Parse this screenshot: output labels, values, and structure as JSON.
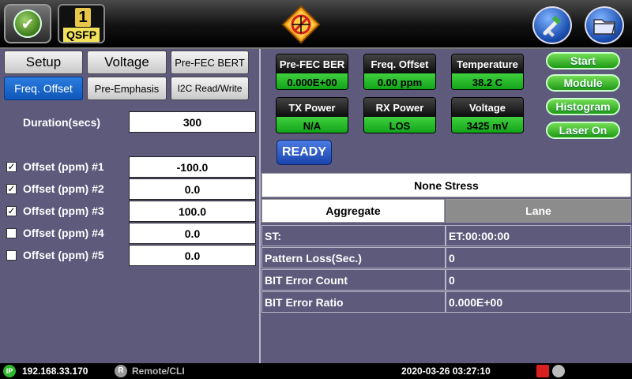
{
  "header": {
    "module_number": "1",
    "module_label": "QSFP"
  },
  "tabs": [
    {
      "label": "Setup"
    },
    {
      "label": "Voltage"
    },
    {
      "label": "Pre-FEC BERT"
    },
    {
      "label": "Freq. Offset"
    },
    {
      "label": "Pre-Emphasis"
    },
    {
      "label": "I2C Read/Write"
    }
  ],
  "duration": {
    "label": "Duration(secs)",
    "value": "300"
  },
  "offsets": [
    {
      "label": "Offset (ppm) #1",
      "value": "-100.0",
      "checked": true
    },
    {
      "label": "Offset (ppm) #2",
      "value": "0.0",
      "checked": true
    },
    {
      "label": "Offset (ppm) #3",
      "value": "100.0",
      "checked": true
    },
    {
      "label": "Offset (ppm) #4",
      "value": "0.0",
      "checked": false
    },
    {
      "label": "Offset (ppm) #5",
      "value": "0.0",
      "checked": false
    }
  ],
  "status_tiles": [
    {
      "title": "Pre-FEC BER",
      "value": "0.000E+00"
    },
    {
      "title": "Freq. Offset",
      "value": "0.00 ppm"
    },
    {
      "title": "Temperature",
      "value": "38.2 C"
    },
    {
      "title": "TX Power",
      "value": "N/A"
    },
    {
      "title": "RX Power",
      "value": "LOS"
    },
    {
      "title": "Voltage",
      "value": "3425 mV"
    }
  ],
  "ready_label": "READY",
  "side_buttons": [
    "Start",
    "Module",
    "Histogram",
    "Laser On"
  ],
  "results": {
    "stress_title": "None Stress",
    "tab_aggregate": "Aggregate",
    "tab_lane": "Lane",
    "rows": [
      {
        "left": "ST:",
        "right": "ET:00:00:00"
      },
      {
        "left": "Pattern Loss(Sec.)",
        "right": "0"
      },
      {
        "left": "BIT Error Count",
        "right": "0"
      },
      {
        "left": "BIT Error Ratio",
        "right": "0.000E+00"
      }
    ]
  },
  "statusbar": {
    "ip_badge": "IP",
    "ip": "192.168.33.170",
    "remote_badge": "R",
    "remote": "Remote/CLI",
    "datetime": "2020-03-26  03:27:10"
  },
  "colors": {
    "accent_green": "#1f9a16",
    "active_tab": "#0f56b8",
    "panel_bg": "#5d5a7c"
  }
}
